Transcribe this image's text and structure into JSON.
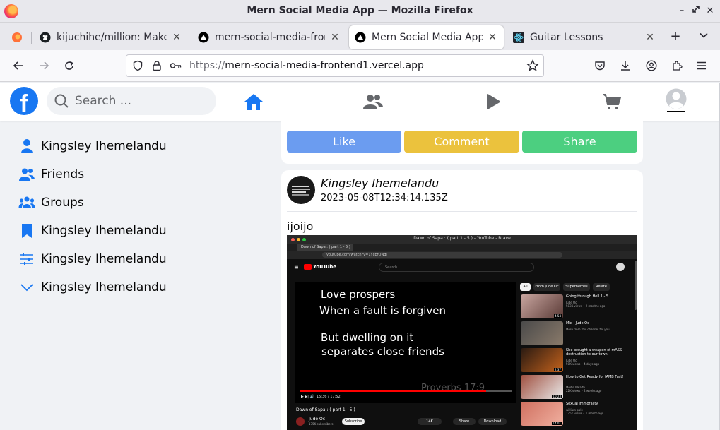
{
  "window": {
    "title": "Mern Social Media App — Mozilla Firefox"
  },
  "tabs": [
    {
      "label": "kijuchihe/million: Make R",
      "icon": "github-icon"
    },
    {
      "label": "mern-social-media-fronte",
      "icon": "vercel-icon"
    },
    {
      "label": "Mern Social Media App",
      "icon": "vercel-icon",
      "active": true
    },
    {
      "label": "Guitar Lessons",
      "icon": "react-icon"
    }
  ],
  "address": {
    "protocol": "https://",
    "host": "mern-social-media-frontend1.vercel.app"
  },
  "header": {
    "logo": "f",
    "search_placeholder": "Search ..."
  },
  "sidebar": {
    "items": [
      {
        "label": "Kingsley Ihemelandu",
        "icon": "user-icon"
      },
      {
        "label": "Friends",
        "icon": "friends-icon"
      },
      {
        "label": "Groups",
        "icon": "groups-icon"
      },
      {
        "label": "Kingsley Ihemelandu",
        "icon": "bookmark-icon"
      },
      {
        "label": "Kingsley Ihemelandu",
        "icon": "sliders-icon"
      },
      {
        "label": "Kingsley Ihemelandu",
        "icon": "chevron-down-icon"
      }
    ]
  },
  "actions": {
    "like": "Like",
    "comment": "Comment",
    "share": "Share"
  },
  "colors": {
    "like": "#6b9cf0",
    "comment": "#ebc23d",
    "share": "#4ccf80",
    "brand": "#1877f2"
  },
  "post": {
    "author": "Kingsley Ihemelandu",
    "timestamp": "2023-05-08T12:34:14.135Z",
    "text": "ijoijo",
    "image": {
      "window_title": "Dawn of Sapa : ( part 1 - 5 ) - YouTube - Brave",
      "tab_label": "Dawn of Sapa : ( part 1 - 5 )",
      "url": "youtube.com/watch?v=1YcErQNql",
      "yt_logo": "YouTube",
      "search_placeholder": "Search",
      "lyrics": [
        "Love prospers",
        "When a fault is forgiven",
        "But dwelling on it",
        "separates close friends"
      ],
      "watermark": "Proverbs 17:9",
      "time": "15:36 / 17:52",
      "progress": 0.88,
      "video_title": "Dawn of Sapa : ( part 1 - 5 )",
      "channel": "Jude Oc",
      "subscribers": "175K subscribers",
      "subscribe": "Subscribe",
      "likes": "14K",
      "share": "Share",
      "download": "Download",
      "chips": [
        "All",
        "From Jude Oc",
        "Superheroes",
        "Relate"
      ],
      "recommendations": [
        {
          "title": "Going through Hell 1 - 5.",
          "meta": "Jude Oc",
          "meta2": "583K views • 9 months ago",
          "duration": "4:54"
        },
        {
          "title": "Mix - Jude Oc",
          "meta": "More from this channel for you",
          "meta2": "",
          "duration": ""
        },
        {
          "title": "She brought a weapon of mASS destruction to our town",
          "meta": "Jude Oc",
          "meta2": "50K views • 4 days ago",
          "duration": "2:37"
        },
        {
          "title": "How to Get Ready for JAMB Fast!",
          "meta": "Medic Wealth",
          "meta2": "22K views • 2 weeks ago",
          "duration": "10:23"
        },
        {
          "title": "Sexual immorality",
          "meta": "william pale",
          "meta2": "175K views • 1 month ago",
          "duration": "14:01"
        }
      ]
    }
  }
}
